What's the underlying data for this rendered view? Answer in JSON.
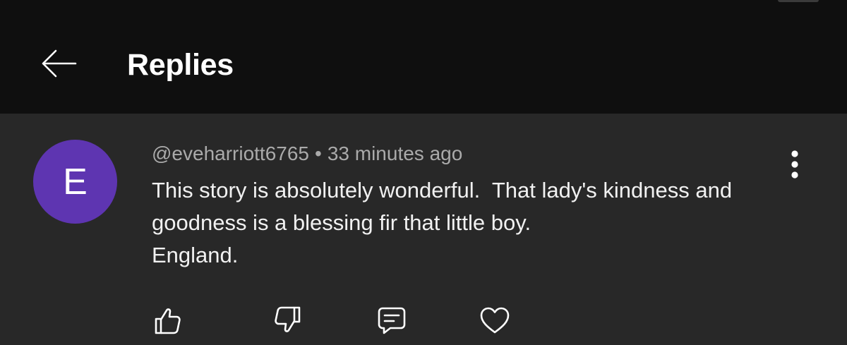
{
  "header": {
    "title": "Replies",
    "back_icon": "arrow-back-icon"
  },
  "comment": {
    "avatar_letter": "E",
    "avatar_color": "#5e35b1",
    "author": "@eveharriott6765",
    "separator": "•",
    "timestamp": "33 minutes ago",
    "text_lines": [
      "This story is absolutely wonderful.  That lady's kindness and",
      "goodness is a blessing fir that little boy.",
      "England."
    ],
    "more_icon": "more-vertical-icon"
  },
  "actions": {
    "like_icon": "thumbs-up-icon",
    "dislike_icon": "thumbs-down-icon",
    "reply_icon": "comment-icon",
    "heart_icon": "heart-icon"
  },
  "colors": {
    "header_bg": "#0f0f0f",
    "body_bg": "#282828",
    "text_primary": "#f1f1f1",
    "text_secondary": "#aaaaaa"
  }
}
